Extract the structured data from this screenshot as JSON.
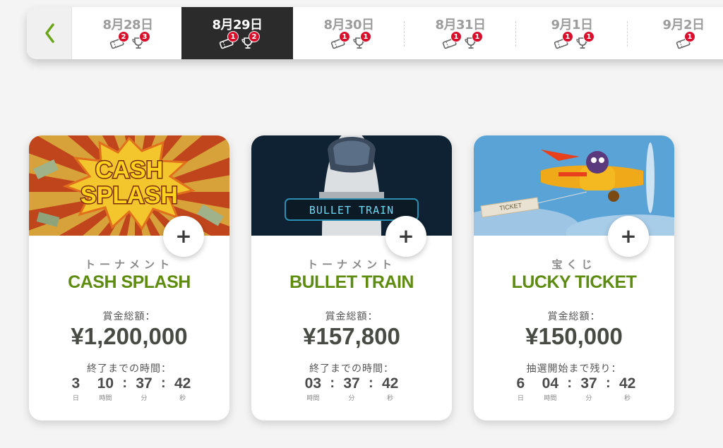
{
  "datebar": {
    "back_icon": "chevron-left-icon",
    "days": [
      {
        "label": "8月28日",
        "ticket_count": "2",
        "trophy_count": "3"
      },
      {
        "label": "8月29日",
        "ticket_count": "1",
        "trophy_count": "2",
        "active": true
      },
      {
        "label": "8月30日",
        "ticket_count": "1",
        "trophy_count": "1"
      },
      {
        "label": "8月31日",
        "ticket_count": "1",
        "trophy_count": "1"
      },
      {
        "label": "9月1日",
        "ticket_count": "1",
        "trophy_count": "1"
      },
      {
        "label": "9月2日",
        "ticket_count": "1"
      }
    ]
  },
  "cards": [
    {
      "banner_text": [
        "CASH",
        "SPLASH"
      ],
      "category": "トーナメント",
      "name": "CASH SPLASH",
      "prize_label": "賞金総額：",
      "prize": "¥1,200,000",
      "time_label": "終了までの時間：",
      "timer": [
        {
          "value": "3",
          "unit": "日"
        },
        {
          "value": "10",
          "unit": "時間"
        },
        {
          "value": "37",
          "unit": "分"
        },
        {
          "value": "42",
          "unit": "秒"
        }
      ]
    },
    {
      "banner_text": [
        "BULLET TRAIN"
      ],
      "category": "トーナメント",
      "name": "BULLET TRAIN",
      "prize_label": "賞金総額：",
      "prize": "¥157,800",
      "time_label": "終了までの時間：",
      "timer": [
        {
          "value": "03",
          "unit": "時間"
        },
        {
          "value": "37",
          "unit": "分"
        },
        {
          "value": "42",
          "unit": "秒"
        }
      ]
    },
    {
      "banner_text": [
        "TICKET"
      ],
      "category": "宝くじ",
      "name": "LUCKY TICKET",
      "prize_label": "賞金総額：",
      "prize": "¥150,000",
      "time_label": "抽選開始まで残り：",
      "timer": [
        {
          "value": "6",
          "unit": "日"
        },
        {
          "value": "04",
          "unit": "時間"
        },
        {
          "value": "37",
          "unit": "分"
        },
        {
          "value": "42",
          "unit": "秒"
        }
      ]
    }
  ],
  "add_button_label": "+",
  "colors": {
    "accent_green": "#5e8c10",
    "badge_red": "#d8102c",
    "active_day_bg": "#2b2b2b"
  }
}
